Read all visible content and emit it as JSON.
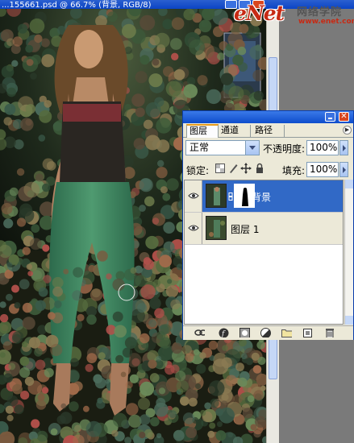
{
  "document": {
    "title": "...155661.psd @ 66.7% (背景, RGB/8)"
  },
  "logo": {
    "brand": "eNet",
    "subtitle": "网络学院",
    "url": "www.enet.com.cn/eschool"
  },
  "layers_panel": {
    "tabs": [
      {
        "label": "图层"
      },
      {
        "label": "通道"
      },
      {
        "label": "路径"
      }
    ],
    "blend_mode": "正常",
    "opacity_label": "不透明度:",
    "opacity_value": "100%",
    "lock_label": "锁定:",
    "fill_label": "填充:",
    "fill_value": "100%",
    "layers": [
      {
        "name": "背景",
        "selected": true,
        "visible": true,
        "has_mask": true
      },
      {
        "name": "图层 1",
        "selected": false,
        "visible": true,
        "has_mask": false
      }
    ],
    "footer_icons": [
      "link-layers-icon",
      "layer-style-icon",
      "add-mask-icon",
      "adjustment-layer-icon",
      "new-group-icon",
      "new-layer-icon",
      "trash-icon"
    ]
  },
  "colors": {
    "selection": "#3169c6",
    "xp_title": "#0b44c4",
    "panel_bg": "#ece9d8"
  }
}
